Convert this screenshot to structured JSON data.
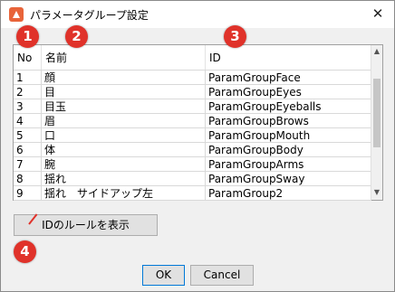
{
  "window": {
    "title": "パラメータグループ設定",
    "close_glyph": "✕"
  },
  "table": {
    "headers": {
      "no": "No",
      "name": "名前",
      "id": "ID"
    },
    "rows": [
      {
        "no": "1",
        "name": "顔",
        "id": "ParamGroupFace"
      },
      {
        "no": "2",
        "name": "目",
        "id": "ParamGroupEyes"
      },
      {
        "no": "3",
        "name": "目玉",
        "id": "ParamGroupEyeballs"
      },
      {
        "no": "4",
        "name": "眉",
        "id": "ParamGroupBrows"
      },
      {
        "no": "5",
        "name": "口",
        "id": "ParamGroupMouth"
      },
      {
        "no": "6",
        "name": "体",
        "id": "ParamGroupBody"
      },
      {
        "no": "7",
        "name": "腕",
        "id": "ParamGroupArms"
      },
      {
        "no": "8",
        "name": "揺れ",
        "id": "ParamGroupSway"
      },
      {
        "no": "9",
        "name": "揺れ　サイドアップ左",
        "id": "ParamGroup2"
      }
    ]
  },
  "buttons": {
    "show_id_rule": "IDのルールを表示",
    "ok": "OK",
    "cancel": "Cancel"
  },
  "annotations": [
    "1",
    "2",
    "3",
    "4"
  ],
  "colors": {
    "badge": "#e0322a",
    "app_icon": "#e8643a",
    "ok_border": "#0078d7"
  }
}
